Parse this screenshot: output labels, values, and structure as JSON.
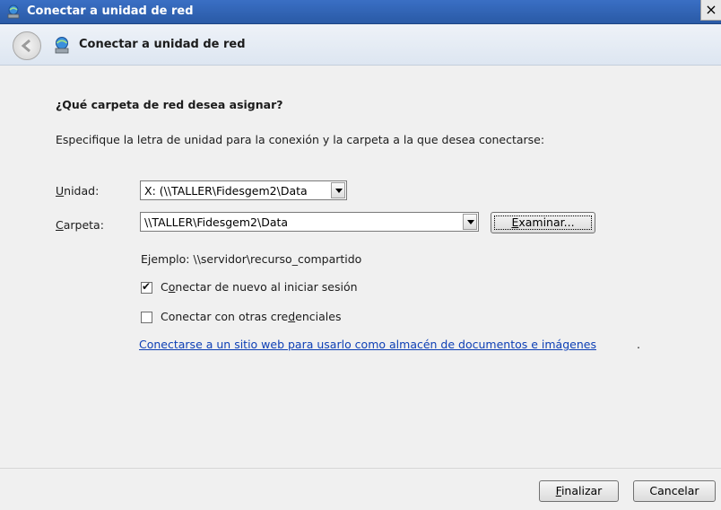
{
  "window": {
    "title": "Conectar a unidad de red",
    "close_glyph": "×"
  },
  "nav": {
    "title": "Conectar a unidad de red"
  },
  "main": {
    "heading": "¿Qué carpeta de red desea asignar?",
    "instructions": "Especifique la letra de unidad para la conexión y la carpeta a la que desea conectarse:",
    "drive": {
      "label_prefix": "",
      "label_access": "U",
      "label_rest": "nidad:",
      "value": "X: (\\\\TALLER\\Fidesgem2\\Data"
    },
    "folder": {
      "label_access": "C",
      "label_rest": "arpeta:",
      "value": "\\\\TALLER\\Fidesgem2\\Data"
    },
    "browse_button": {
      "access": "E",
      "rest": "xaminar..."
    },
    "example": "Ejemplo: \\\\servidor\\recurso_compartido",
    "reconnect": {
      "checked": true,
      "pre": "C",
      "access": "o",
      "post": "nectar de nuevo al iniciar sesión"
    },
    "other_credentials": {
      "checked": false,
      "pre": "Conectar con otras cre",
      "access": "d",
      "post": "enciales"
    },
    "link": "Conectarse a un sitio web para usarlo como almacén de documentos e imágenes",
    "link_suffix": "."
  },
  "footer": {
    "finish": {
      "access": "F",
      "rest": "inalizar"
    },
    "cancel": "Cancelar"
  },
  "colors": {
    "titlebar": "#2f63b7",
    "link": "#0d3fb5",
    "content_bg": "#f0f0f0"
  }
}
